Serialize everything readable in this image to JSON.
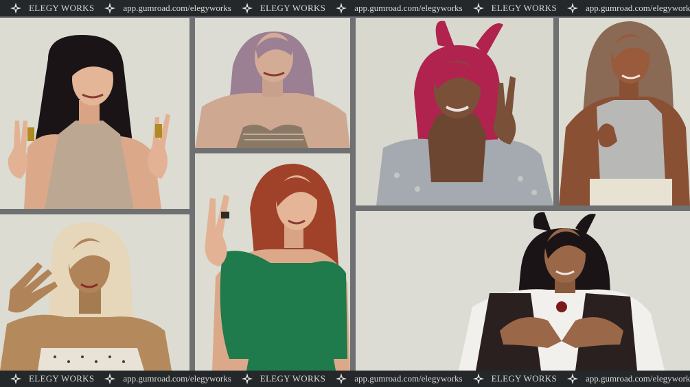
{
  "watermark": {
    "brand": "ELEGY WORKS",
    "url": "app.gumroad.com/elegyworks",
    "star_icon": "four-point-star-icon"
  },
  "colors": {
    "band_bg": "#24282a",
    "band_text": "#d9d9d6",
    "frame_gap": "#6e7072",
    "panel_bg": "#dcdcd4"
  }
}
